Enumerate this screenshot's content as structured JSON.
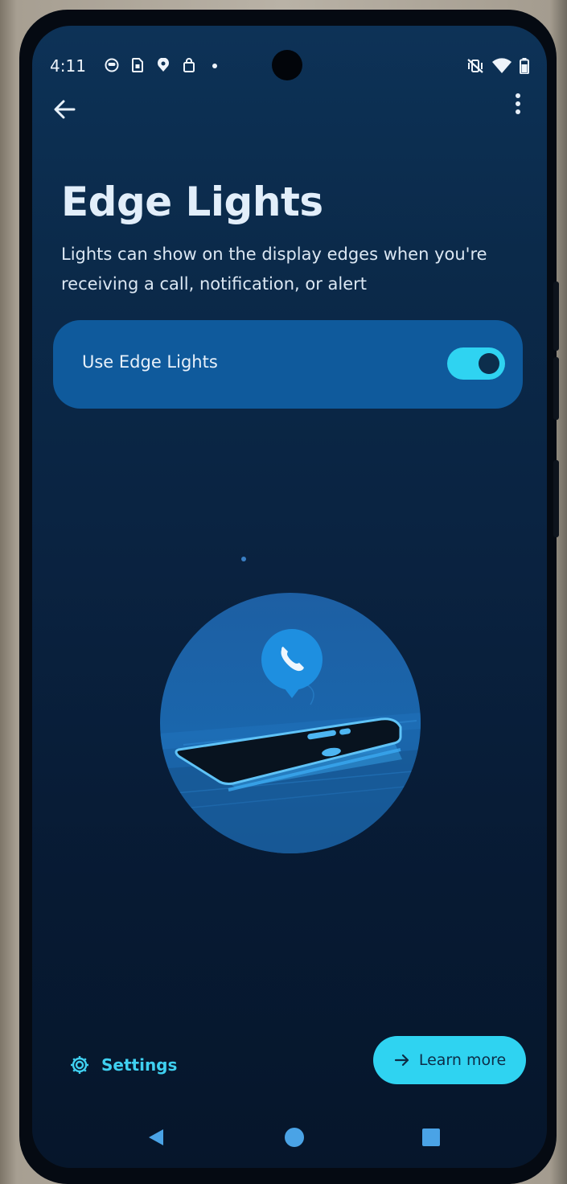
{
  "status_bar": {
    "time": "4:11",
    "notification_icons": [
      "face-icon",
      "sim-icon",
      "location-pin-icon",
      "shopping-bag-icon",
      "more-dot-icon"
    ],
    "right_icons": [
      "vibrate-off-icon",
      "wifi-icon",
      "battery-icon"
    ]
  },
  "app_bar": {
    "back_icon": "back-arrow-icon",
    "menu_icon": "more-vert-icon"
  },
  "page": {
    "title": "Edge Lights",
    "subtitle": "Lights can show on the display edges when you're receiving a call, notification, or alert"
  },
  "toggle": {
    "label": "Use Edge Lights",
    "checked": true
  },
  "illustration": {
    "icon": "phone-call-icon"
  },
  "actions": {
    "settings_label": "Settings",
    "settings_icon": "gear-icon",
    "learn_more_label": "Learn more",
    "learn_more_icon": "arrow-right-icon"
  },
  "nav_bar": {
    "items": [
      "back-triangle-icon",
      "home-circle-icon",
      "recents-square-icon"
    ]
  },
  "colors": {
    "accent": "#2fd3f1",
    "card": "#0f5a9c",
    "background": "#0a2341",
    "text": "#e2eefa"
  }
}
